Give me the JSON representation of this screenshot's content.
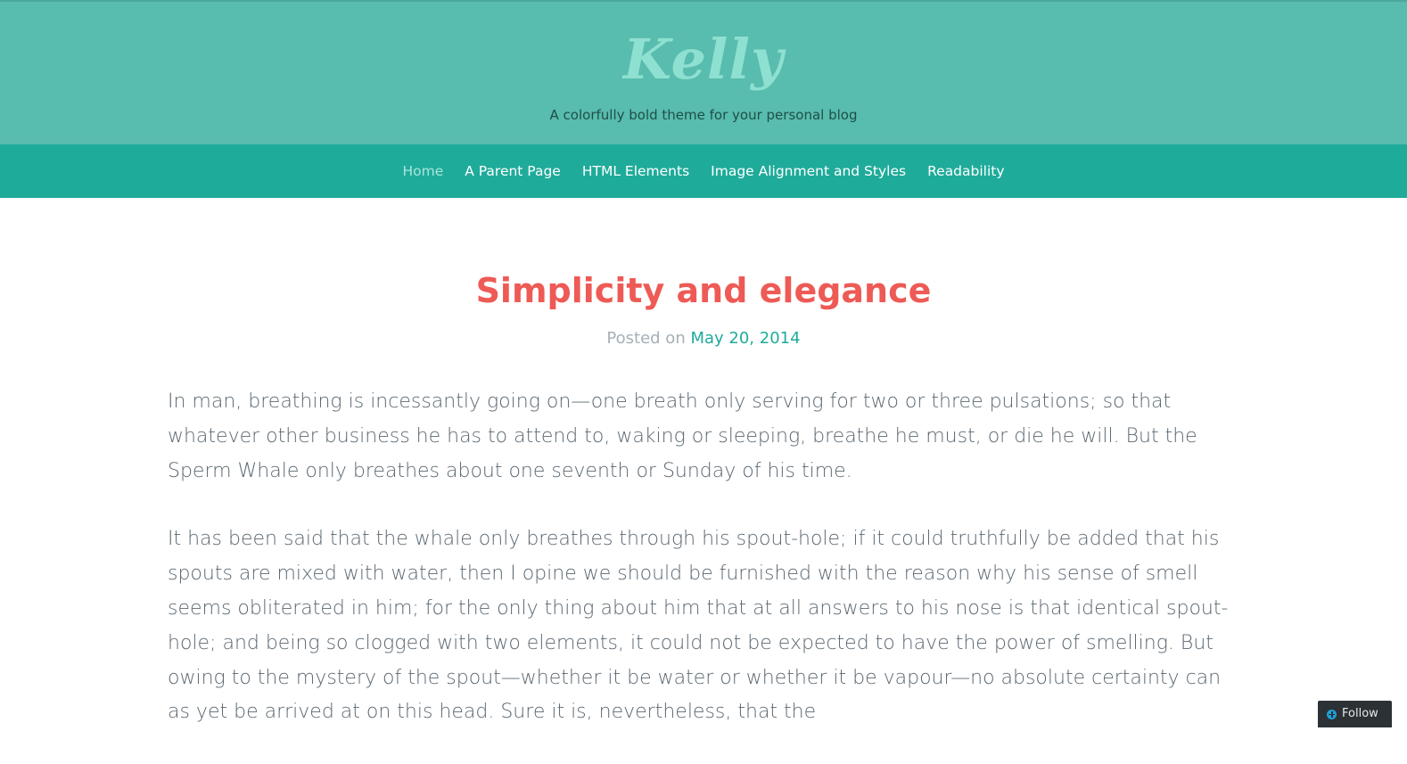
{
  "header": {
    "site_title": "Kelly",
    "tagline": "A colorfully bold theme for your personal blog"
  },
  "nav": {
    "items": [
      {
        "label": "Home",
        "current": true
      },
      {
        "label": "A Parent Page"
      },
      {
        "label": "HTML Elements"
      },
      {
        "label": "Image Alignment and Styles"
      },
      {
        "label": "Readability"
      }
    ]
  },
  "post": {
    "title": "Simplicity and elegance",
    "posted_on_label": "Posted on",
    "date": "May 20, 2014",
    "paragraphs": [
      "In man, breathing is incessantly going on—one breath only serving for two or three pulsations; so that whatever other business he has to attend to, waking or sleeping, breathe he must, or die he will. But the Sperm Whale only breathes about one seventh or Sunday of his time.",
      "It has been said that the whale only breathes through his spout-hole; if it could truthfully be added that his spouts are mixed with water, then I opine we should be furnished with the reason why his sense of smell seems obliterated in him; for the only thing about him that at all answers to his nose is that identical spout-hole; and being so clogged with two elements, it could not be expected to have the power of smelling. But owing to the mystery of the spout—whether it be water or whether it be vapour—no absolute certainty can as yet be arrived at on this head. Sure it is, nevertheless, that the"
    ]
  },
  "follow": {
    "label": "Follow",
    "icon": "plus-circle-icon"
  },
  "colors": {
    "header_bg": "#58bcae",
    "nav_bg": "#1fab9a",
    "title": "#ee5a55",
    "accent": "#1fab9a",
    "body_text": "#5b6872"
  }
}
